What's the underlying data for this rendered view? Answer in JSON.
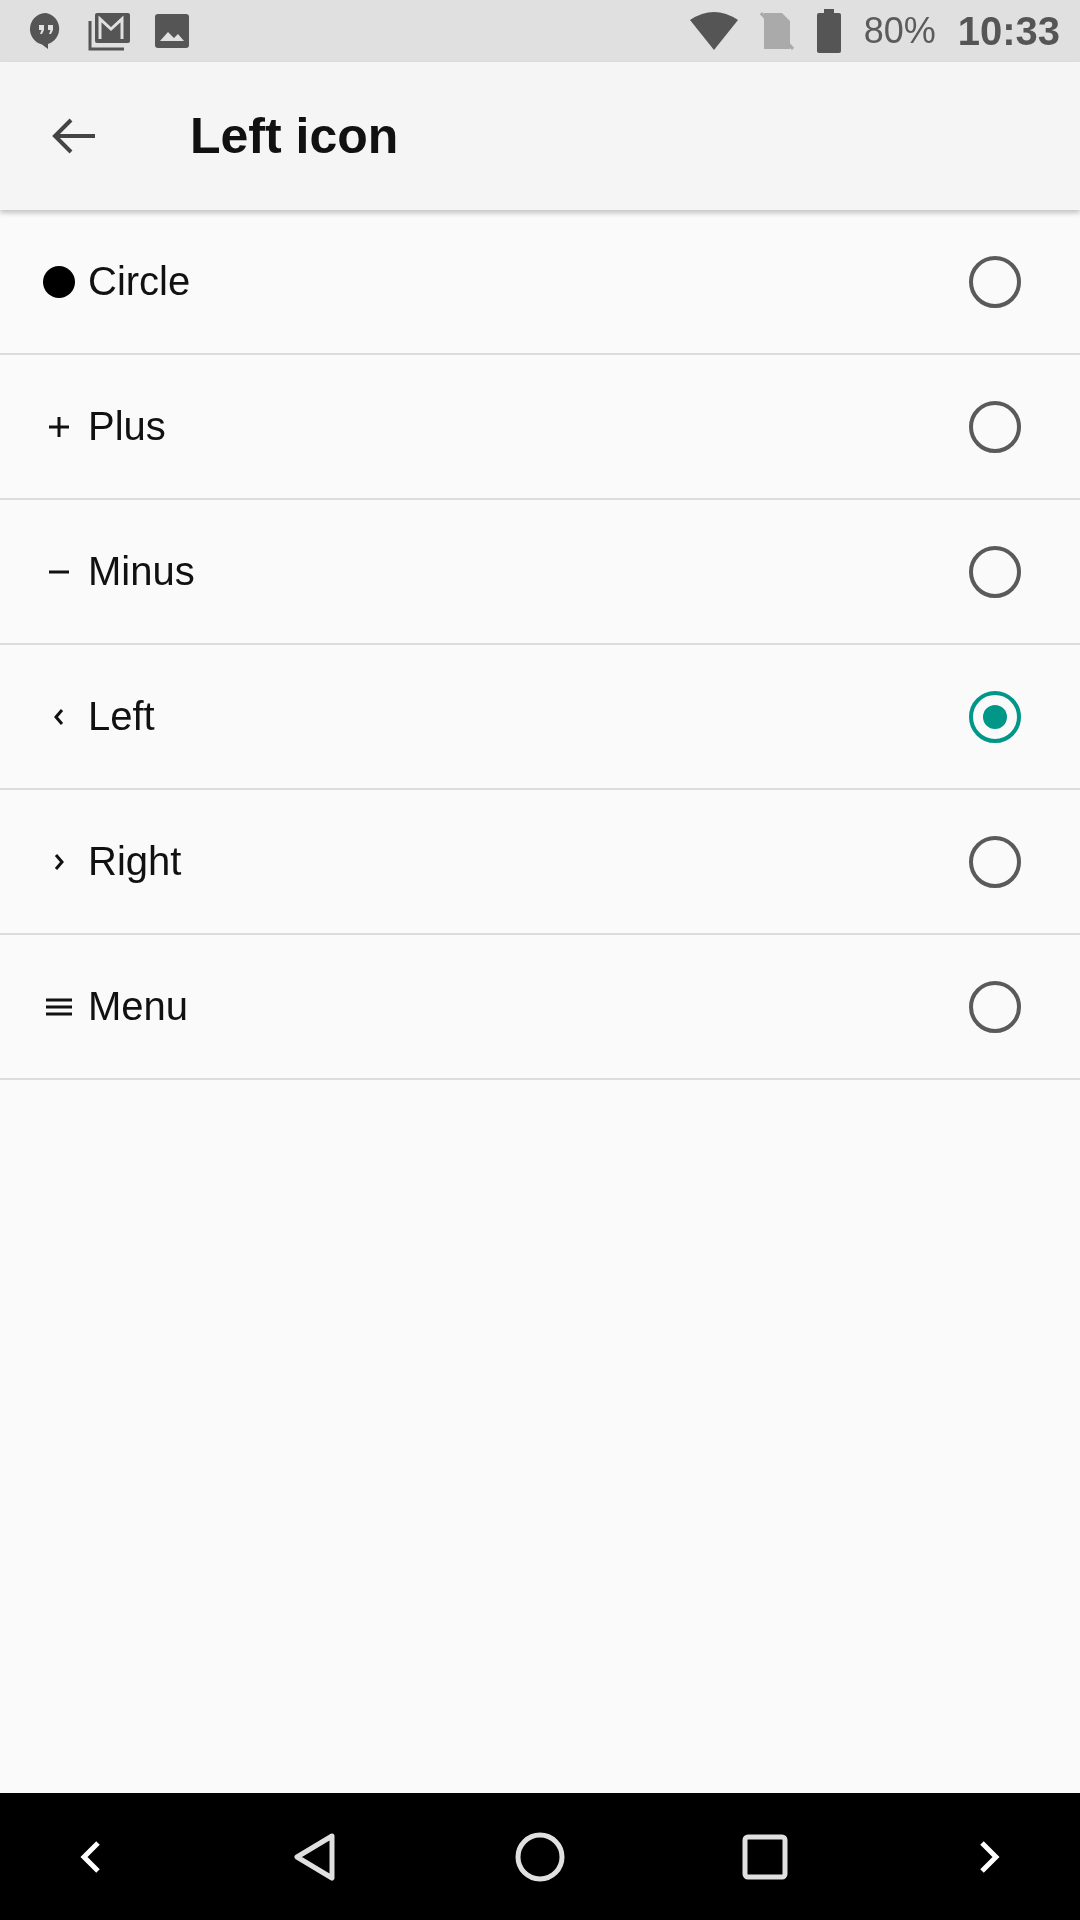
{
  "status_bar": {
    "battery": "80%",
    "time": "10:33"
  },
  "app_bar": {
    "title": "Left icon"
  },
  "options": [
    {
      "kind": "circle",
      "label": "Circle",
      "selected": false
    },
    {
      "kind": "plus",
      "label": "Plus",
      "selected": false
    },
    {
      "kind": "minus",
      "label": "Minus",
      "selected": false
    },
    {
      "kind": "left",
      "label": "Left",
      "selected": true
    },
    {
      "kind": "right",
      "label": "Right",
      "selected": false
    },
    {
      "kind": "menu",
      "label": "Menu",
      "selected": false
    }
  ]
}
